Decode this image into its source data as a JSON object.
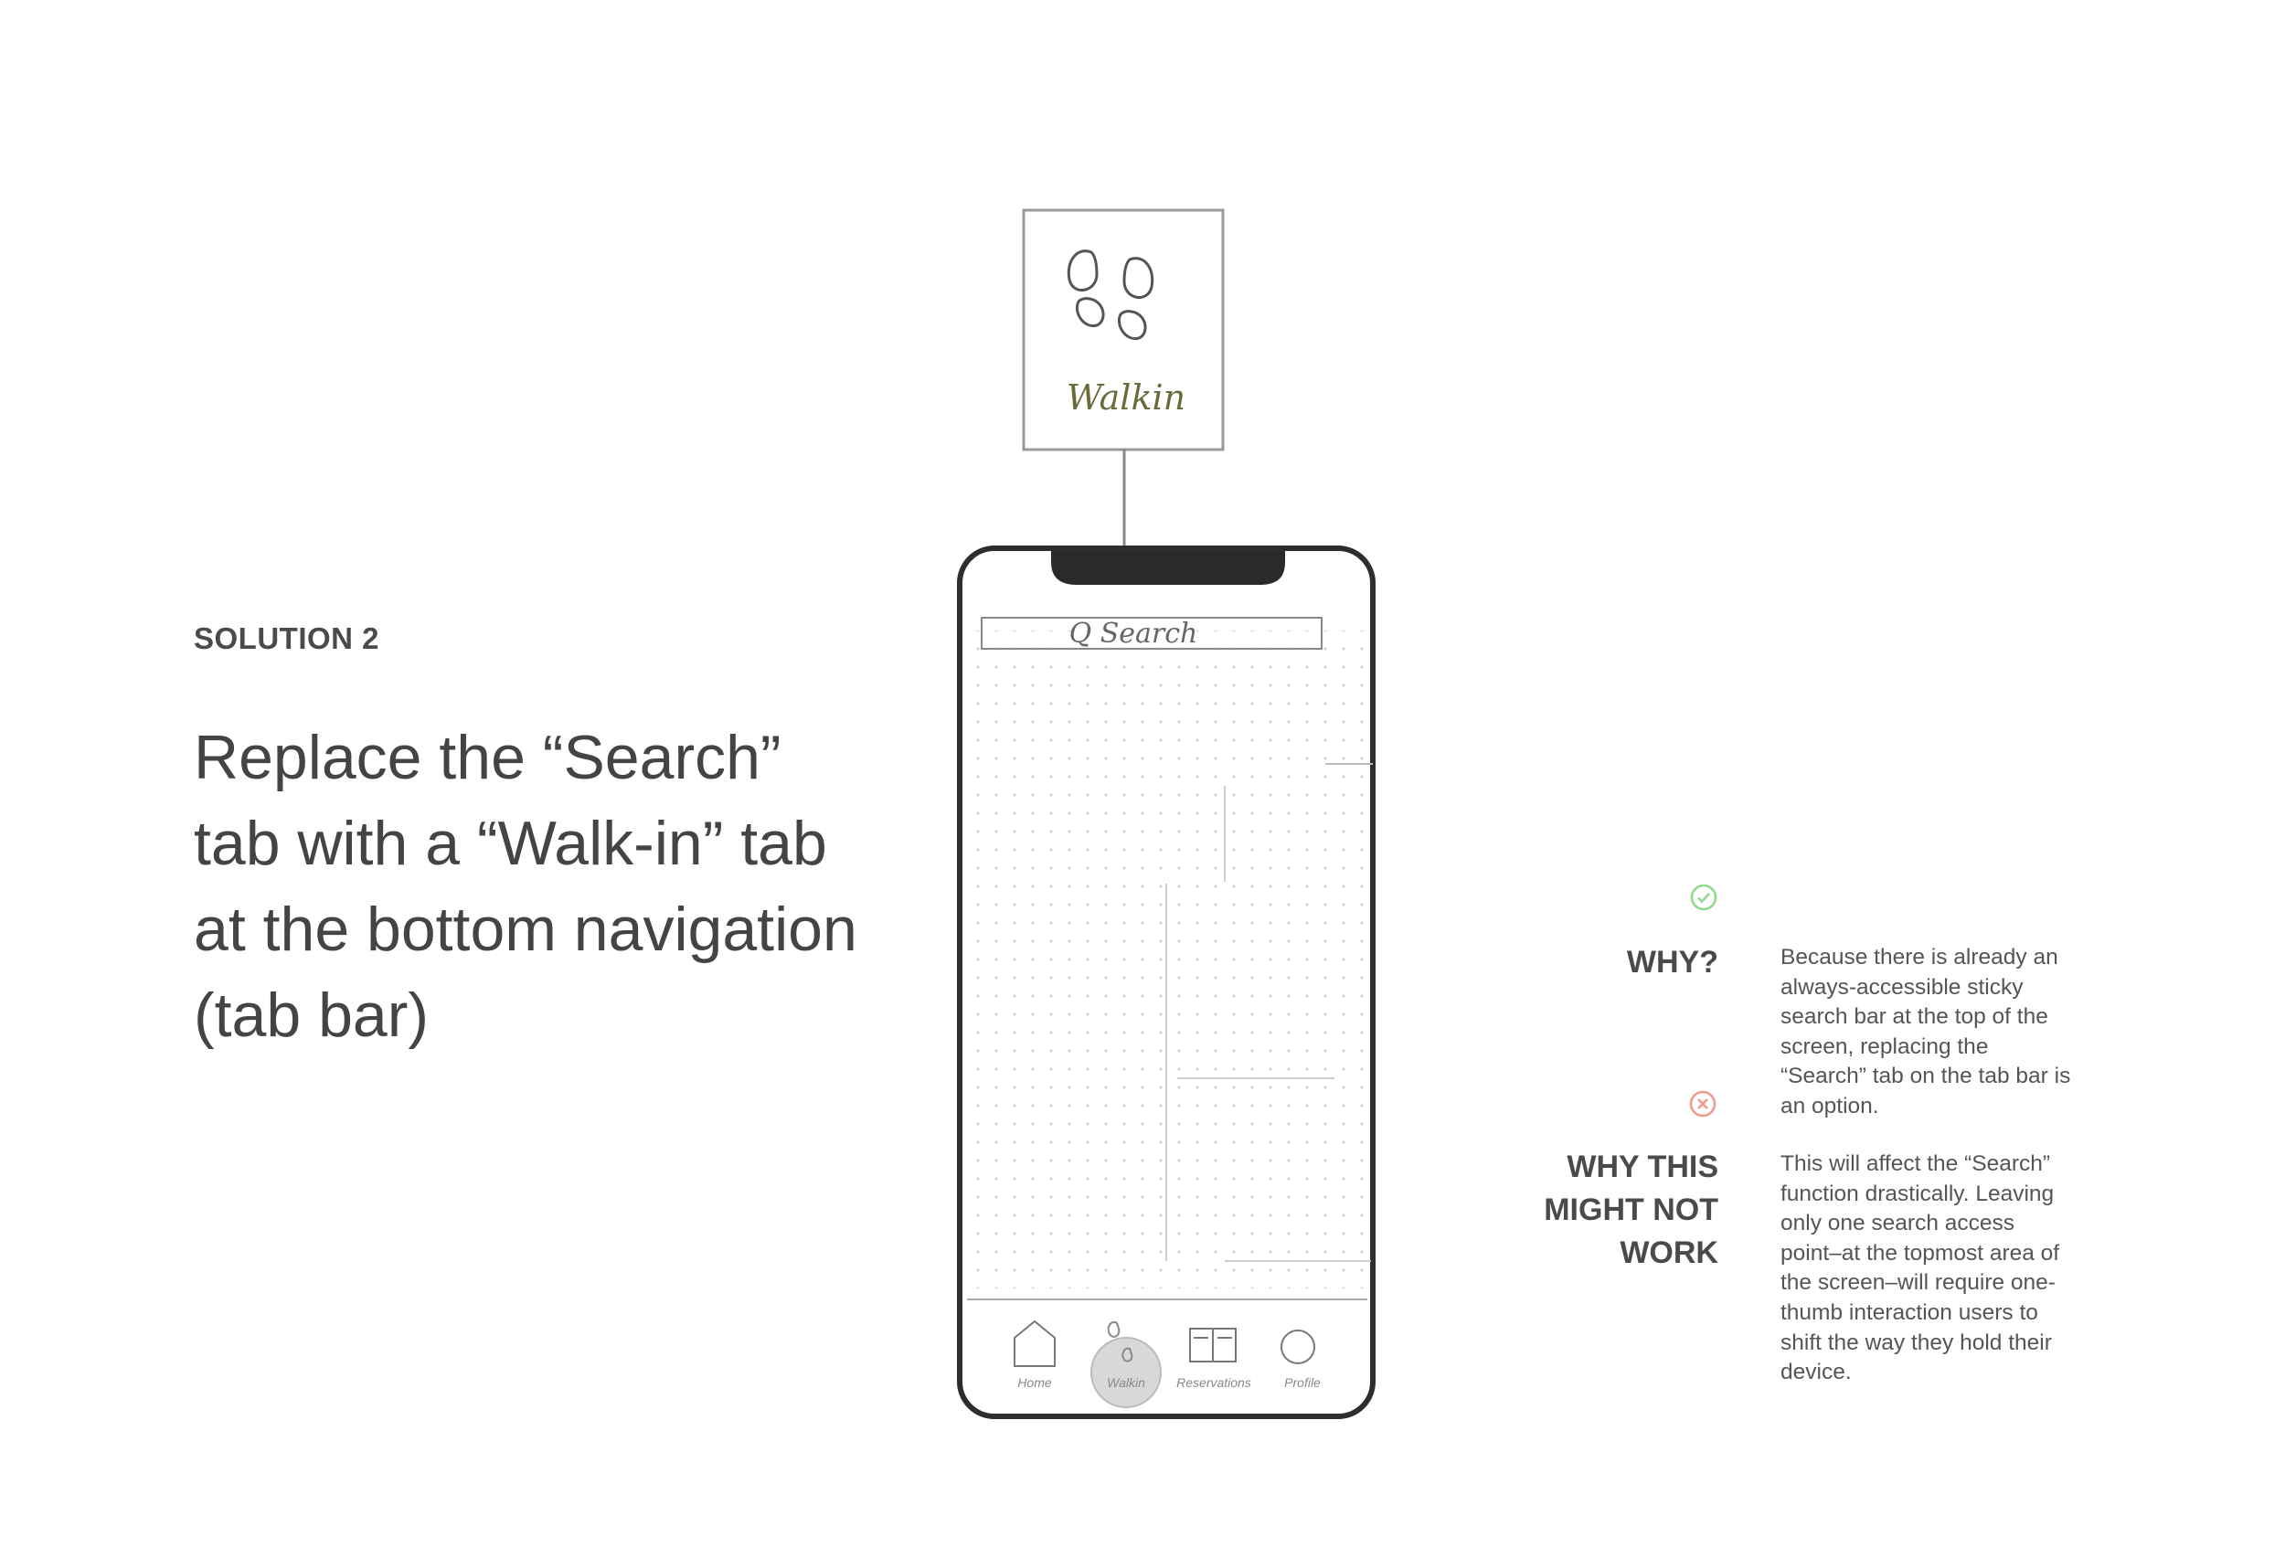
{
  "slide": {
    "label": "SOLUTION 2",
    "headline": "Replace the “Search” tab with a “Walk-in” tab at the bottom navigation (tab bar)"
  },
  "sketch": {
    "callout_label": "Walkin",
    "search_bar_text": "Q Search",
    "tabs": [
      {
        "label": "Home",
        "icon": "house-icon"
      },
      {
        "label": "Walkin",
        "icon": "footprints-icon"
      },
      {
        "label": "Reservations",
        "icon": "book-icon"
      },
      {
        "label": "Profile",
        "icon": "profile-icon"
      }
    ],
    "highlighted_tab": "Walkin"
  },
  "why": {
    "icon": "check-circle-icon",
    "icon_color": "#8ed98e",
    "title": "WHY?",
    "body": "Because there is already an always-accessible sticky search bar at the top of the screen, replacing the “Search” tab on the tab bar is an option."
  },
  "why_not": {
    "icon": "x-circle-icon",
    "icon_color": "#ef9a8a",
    "title_lines": [
      "WHY THIS",
      "MIGHT NOT",
      "WORK"
    ],
    "body": "This will affect the “Search” function drastically. Leaving only one search access point–at the topmost area of the screen–will require one-thumb interaction users to shift the way they hold their device."
  }
}
